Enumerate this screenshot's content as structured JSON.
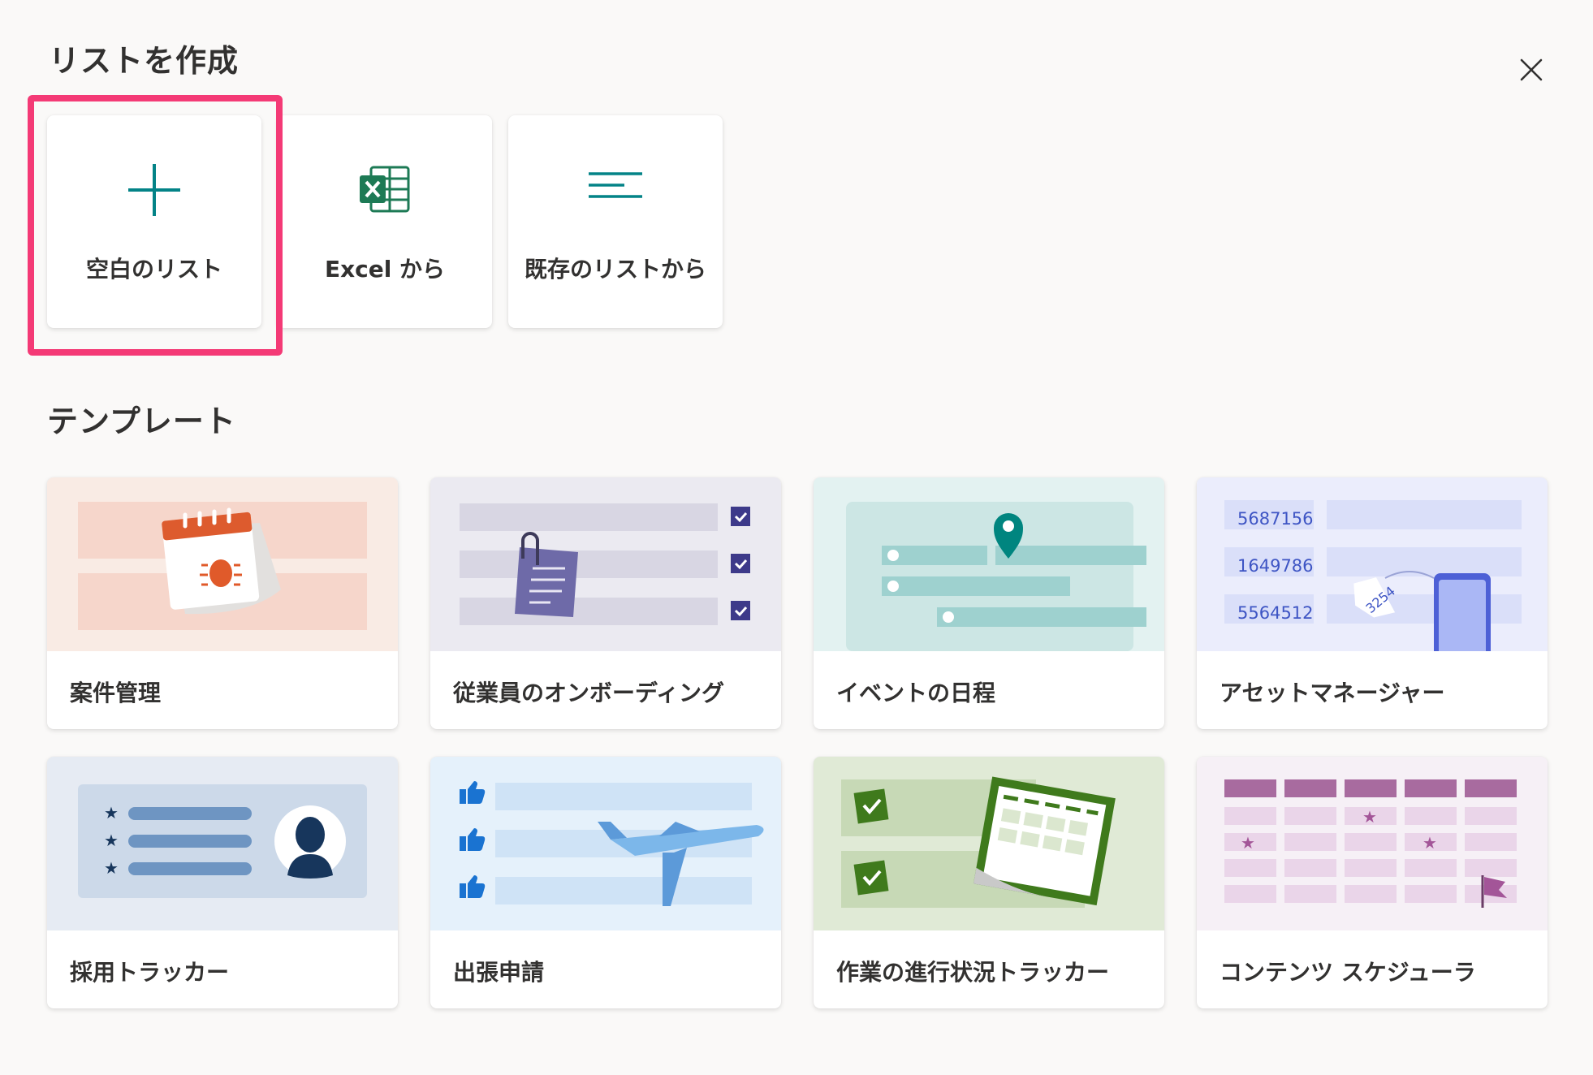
{
  "dialog": {
    "title": "リストを作成",
    "close_icon": "close-icon"
  },
  "create_options": [
    {
      "label": "空白のリスト",
      "icon": "plus-icon"
    },
    {
      "label": "Excel から",
      "icon": "excel-icon"
    },
    {
      "label": "既存のリストから",
      "icon": "list-lines-icon"
    }
  ],
  "templates_section": {
    "heading": "テンプレート",
    "items": [
      {
        "label": "案件管理",
        "thumb_bg": "#f9ebe4"
      },
      {
        "label": "従業員のオンボーディング",
        "thumb_bg": "#ebeaf1"
      },
      {
        "label": "イベントの日程",
        "thumb_bg": "#e3f2f1"
      },
      {
        "label": "アセットマネージャー",
        "thumb_bg": "#ebedfc"
      },
      {
        "label": "採用トラッカー",
        "thumb_bg": "#e6ebf3"
      },
      {
        "label": "出張申請",
        "thumb_bg": "#e5f1fb"
      },
      {
        "label": "作業の進行状況トラッカー",
        "thumb_bg": "#e0ead6"
      },
      {
        "label": "コンテンツ スケジューラ",
        "thumb_bg": "#f6f0f6"
      }
    ],
    "asset_numbers": [
      "5687156",
      "1649786",
      "5564512"
    ],
    "asset_tag_number": "3254"
  },
  "colors": {
    "accent_teal": "#038387",
    "excel_green": "#1d7a55",
    "highlight_pink": "#f43a76"
  }
}
